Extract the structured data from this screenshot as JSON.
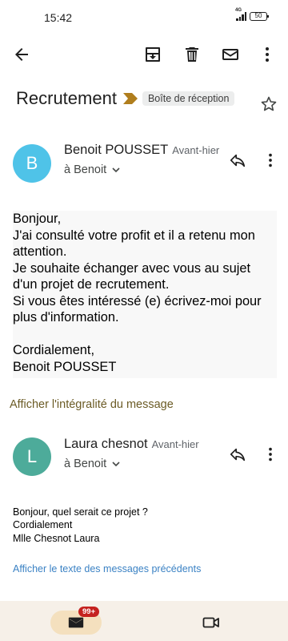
{
  "status_bar": {
    "time": "15:42",
    "network": "4G",
    "battery": "50"
  },
  "toolbar": {
    "back_icon": "arrow-left-icon",
    "archive_icon": "archive-icon",
    "delete_icon": "trash-icon",
    "mark_unread_icon": "mail-icon",
    "more_icon": "more-vert-icon"
  },
  "thread": {
    "subject": "Recrutement",
    "label": "Boîte de réception",
    "importance_color": "#b07e1d",
    "star_icon": "star-outline-icon"
  },
  "messages": [
    {
      "avatar_letter": "B",
      "avatar_color": "#4fc3e8",
      "sender": "Benoit POUSSET",
      "date": "Avant-hier",
      "recipient": "à Benoit",
      "body": "Bonjour,\nJ'ai consulté votre profit et il a retenu mon attention.\nJe souhaite échanger avec vous au sujet d'un projet de recrutement.\nSi vous êtes intéressé (e) écrivez-moi pour plus d'information.\n\nCordialement,\nBenoit POUSSET",
      "show_full_link": "Afficher l'intégralité du message"
    },
    {
      "avatar_letter": "L",
      "avatar_color": "#4dab9a",
      "sender": "Laura chesnot",
      "date": "Avant-hier",
      "recipient": "à Benoit",
      "body": "Bonjour, quel serait ce projet ?\nCordialement\nMlle Chesnot Laura",
      "show_previous_link": "Afficher le texte des messages précédents"
    }
  ],
  "bottom_nav": {
    "mail_icon": "mail-filled-icon",
    "mail_badge": "99+",
    "meet_icon": "video-camera-icon"
  }
}
